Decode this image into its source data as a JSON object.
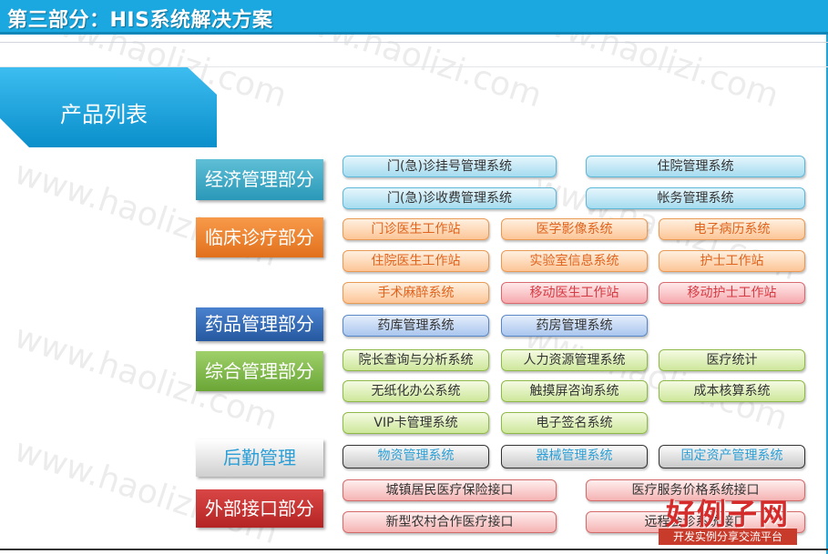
{
  "header": {
    "title": "第三部分：HIS系统解决方案"
  },
  "banner": {
    "label": "产品列表"
  },
  "watermark": "www.haolizi.com",
  "categories": [
    {
      "label": "经济管理部分"
    },
    {
      "label": "临床诊疗部分"
    },
    {
      "label": "药品管理部分"
    },
    {
      "label": "综合管理部分"
    },
    {
      "label": "后勤管理"
    },
    {
      "label": "外部接口部分"
    }
  ],
  "systems": {
    "economic": [
      "门(急)诊挂号管理系统",
      "住院管理系统",
      "门(急)诊收费管理系统",
      "帐务管理系统"
    ],
    "clinical": [
      "门诊医生工作站",
      "医学影像系统",
      "电子病历系统",
      "住院医生工作站",
      "实验室信息系统",
      "护士工作站",
      "手术麻醉系统",
      "移动医生工作站",
      "移动护士工作站"
    ],
    "pharmacy": [
      "药库管理系统",
      "药房管理系统"
    ],
    "general": [
      "院长查询与分析系统",
      "人力资源管理系统",
      "医疗统计",
      "无纸化办公系统",
      "触摸屏咨询系统",
      "成本核算系统",
      "VIP卡管理系统",
      "电子签名系统"
    ],
    "logistics": [
      "物资管理系统",
      "器械管理系统",
      "固定资产管理系统"
    ],
    "interface": [
      "城镇居民医疗保险接口",
      "医疗服务价格系统接口",
      "新型农村合作医疗接口",
      "远程会诊系统接口"
    ]
  },
  "logo": {
    "main": "好例子网",
    "sub": "开发实例分享交流平台"
  },
  "colors": {
    "header": "#1ba8e0",
    "banner": "#12a3dc"
  }
}
